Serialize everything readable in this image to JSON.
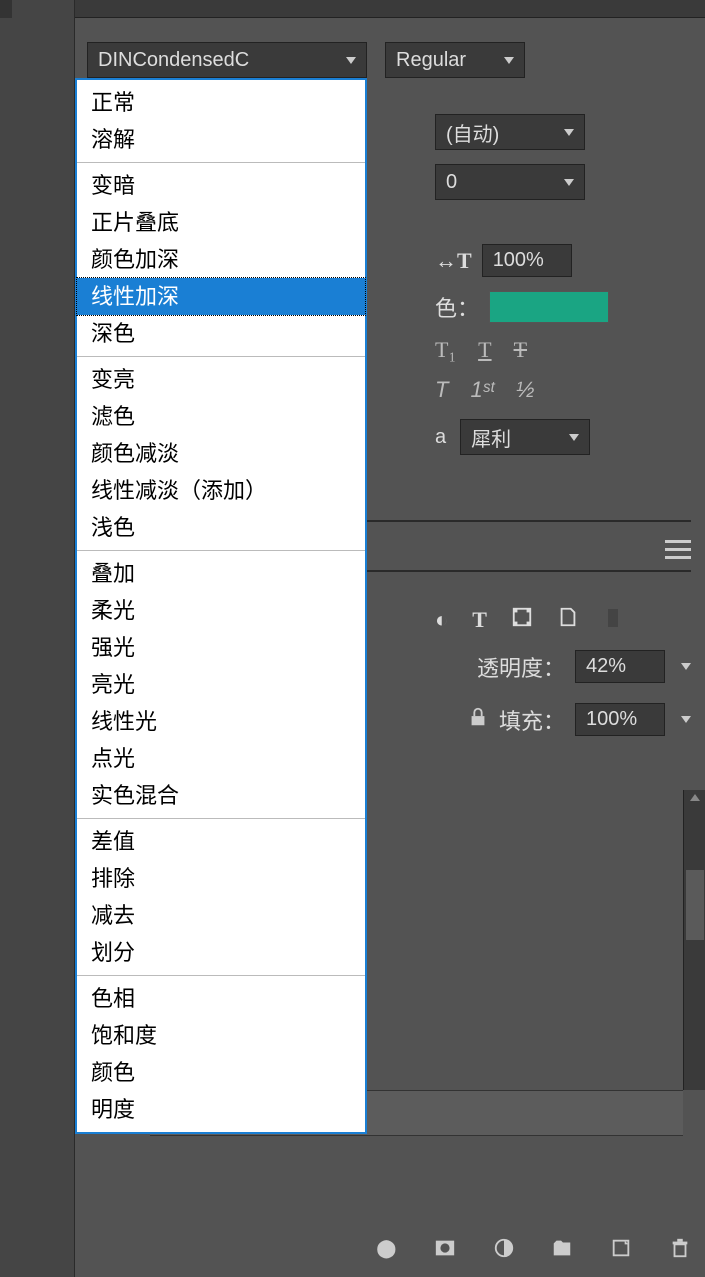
{
  "font": {
    "family": "DINCondensedC",
    "style": "Regular",
    "leading": "(自动)",
    "tracking": "0",
    "scale": "100%",
    "color_label": "色：",
    "aa_mode": "犀利",
    "aa_prefix": "a"
  },
  "blend_groups": [
    {
      "items": [
        "正常",
        "溶解"
      ]
    },
    {
      "items": [
        "变暗",
        "正片叠底",
        "颜色加深",
        "线性加深",
        "深色"
      ]
    },
    {
      "items": [
        "变亮",
        "滤色",
        "颜色减淡",
        "线性减淡（添加）",
        "浅色"
      ]
    },
    {
      "items": [
        "叠加",
        "柔光",
        "强光",
        "亮光",
        "线性光",
        "点光",
        "实色混合"
      ]
    },
    {
      "items": [
        "差值",
        "排除",
        "减去",
        "划分"
      ]
    },
    {
      "items": [
        "色相",
        "饱和度",
        "颜色",
        "明度"
      ]
    }
  ],
  "blend_selected": "线性加深",
  "layers": {
    "opacity_label": "透明度：",
    "opacity": "42%",
    "fill_label": "填充：",
    "fill": "100%"
  },
  "typo_icons1": [
    "T₁",
    "T",
    "Ŧ"
  ],
  "typo_icons2": [
    "T",
    "1ˢᵗ",
    "½"
  ]
}
